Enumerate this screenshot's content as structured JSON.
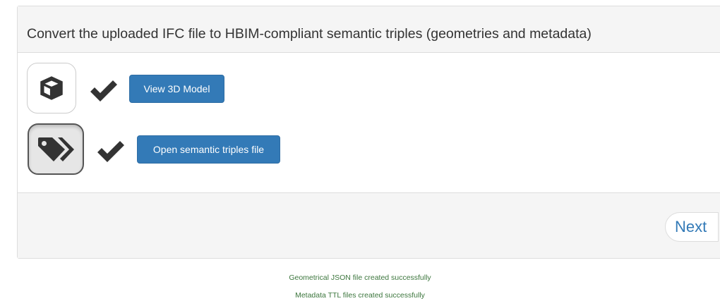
{
  "panel": {
    "title": "Convert the uploaded IFC file to HBIM-compliant semantic triples (geometries and metadata)"
  },
  "steps": [
    {
      "icon": "cube-icon",
      "status_icon": "check-icon",
      "button_label": "View 3D Model"
    },
    {
      "icon": "tags-icon",
      "status_icon": "check-icon",
      "button_label": "Open semantic triples file"
    }
  ],
  "footer": {
    "next_label": "Next"
  },
  "messages": [
    "Geometrical JSON file created successfully",
    "Metadata TTL files created successfully"
  ],
  "colors": {
    "primary": "#337ab7",
    "success_text": "#3c763d",
    "panel_bg": "#f5f5f5",
    "icon_dark": "#333333"
  }
}
